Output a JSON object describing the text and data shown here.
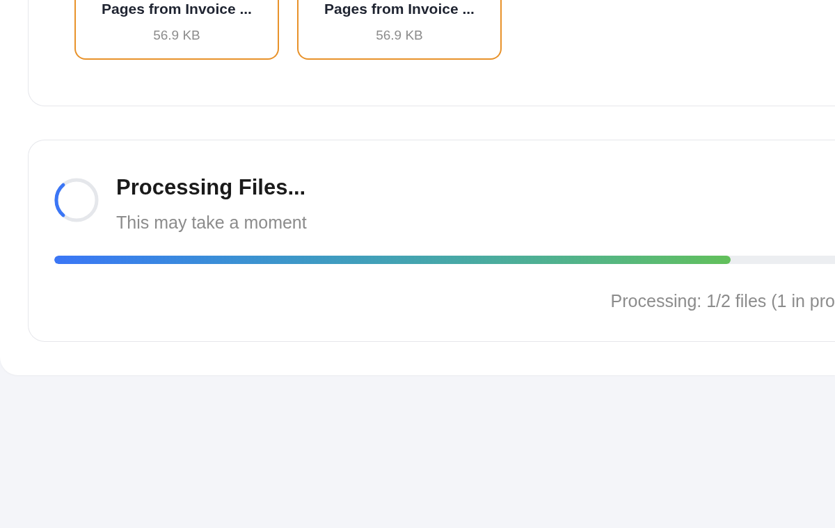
{
  "files": [
    {
      "name": "Pages from Invoice ...",
      "size": "56.9 KB"
    },
    {
      "name": "Pages from Invoice ...",
      "size": "56.9 KB"
    }
  ],
  "processing": {
    "title": "Processing Files...",
    "subtitle": "This may take a moment",
    "progress": {
      "level": 0.866
    },
    "status": "Processing: 1/2 files (1 in pro"
  }
}
